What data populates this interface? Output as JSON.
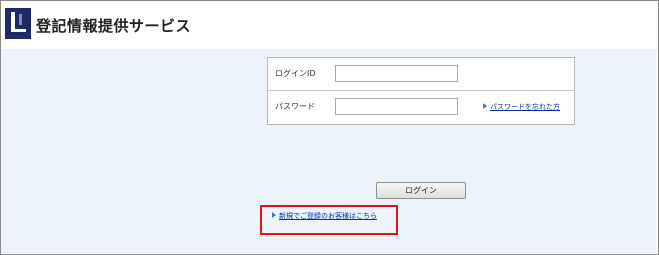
{
  "header": {
    "logo_icon": "registry-logo-icon",
    "title": "登記情報提供サービス"
  },
  "login_form": {
    "login_id": {
      "label": "ログインID",
      "value": ""
    },
    "password": {
      "label": "パスワード",
      "value": ""
    },
    "forgot_password_link": "パスワードを忘れた方",
    "login_button": "ログイン"
  },
  "register_link": "新規でご登録のお客様はこちら",
  "colors": {
    "link": "#0033aa",
    "highlight": "#e01616",
    "background": "#edf3fb"
  }
}
